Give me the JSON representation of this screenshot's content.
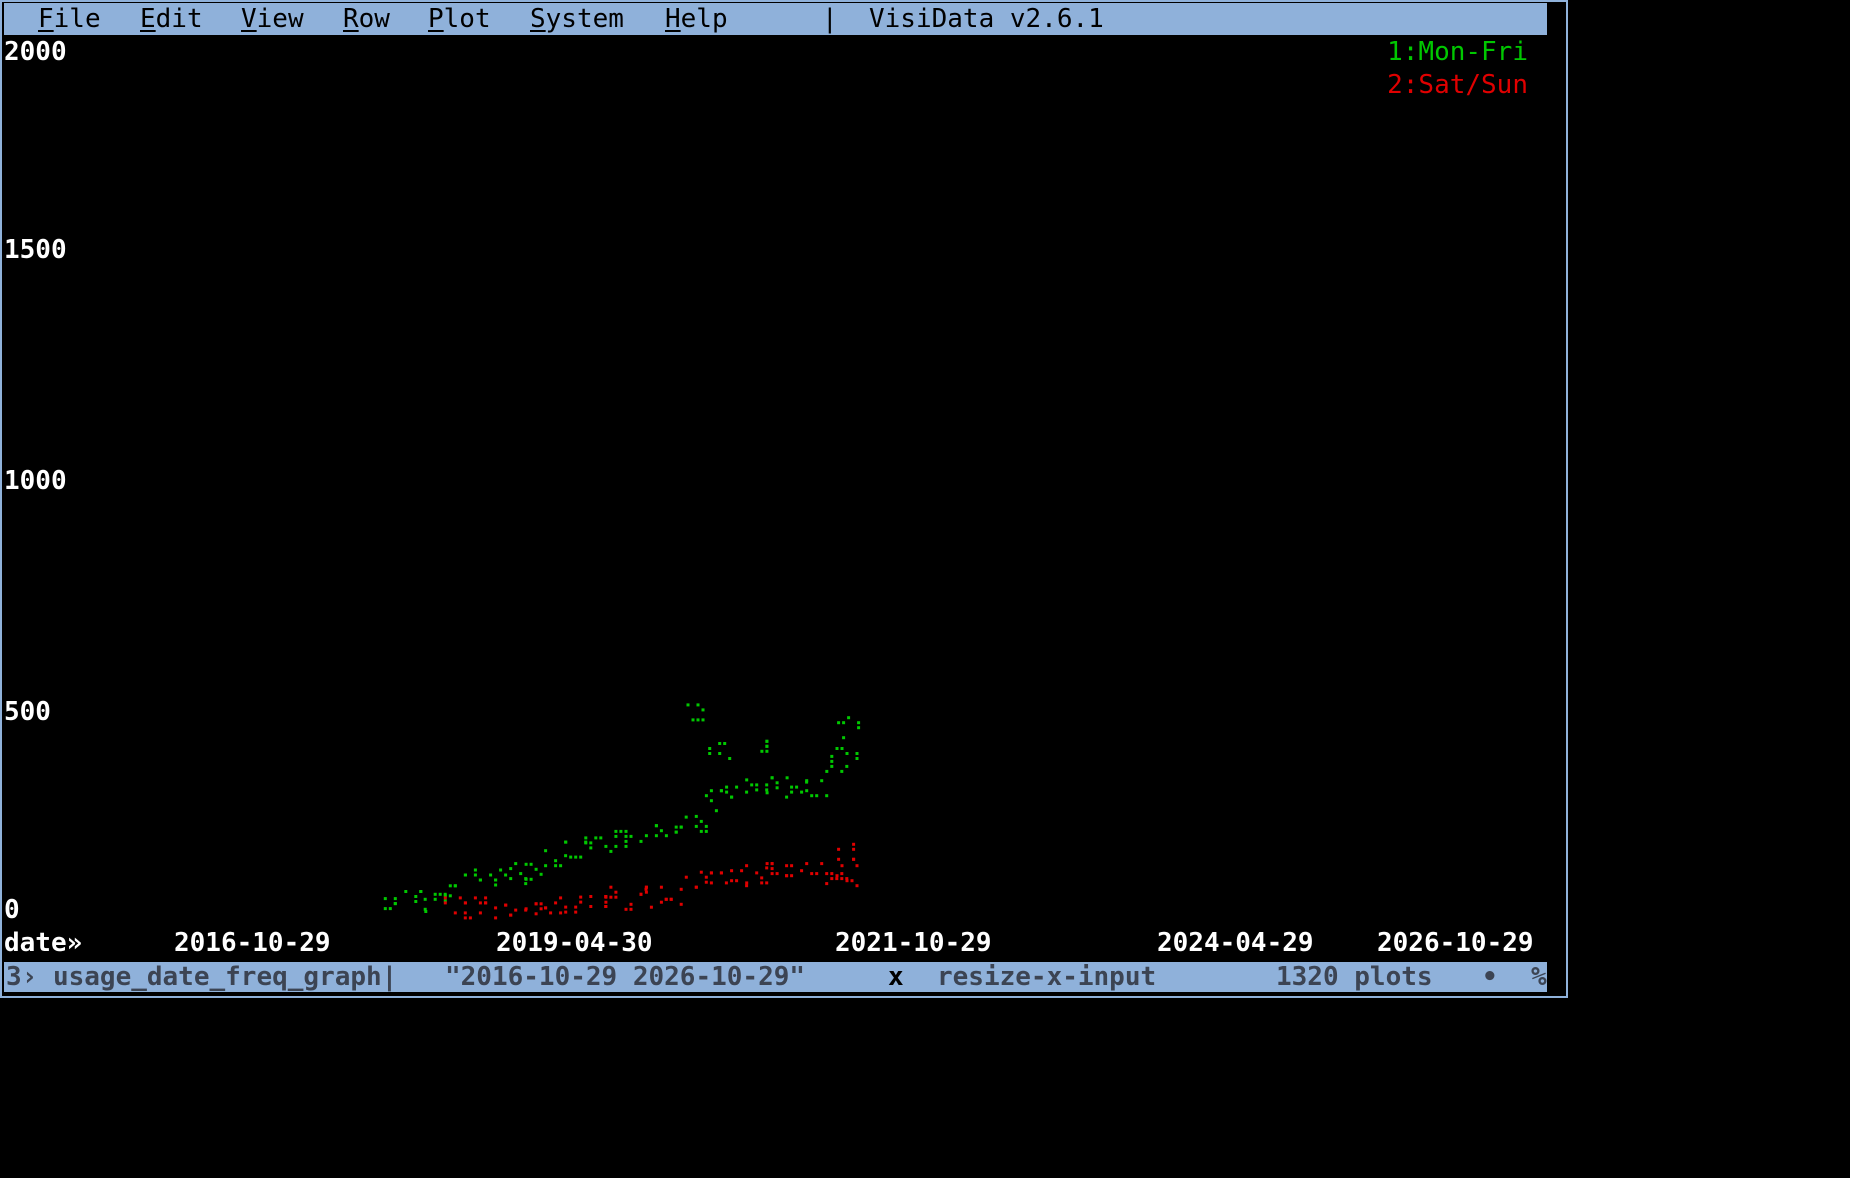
{
  "menu": {
    "items": [
      {
        "first": "F",
        "rest": "ile"
      },
      {
        "first": "E",
        "rest": "dit"
      },
      {
        "first": "V",
        "rest": "iew"
      },
      {
        "first": "R",
        "rest": "ow"
      },
      {
        "first": "P",
        "rest": "lot"
      },
      {
        "first": "S",
        "rest": "ystem"
      },
      {
        "first": "H",
        "rest": "elp"
      }
    ],
    "separator": "|",
    "app_title": "VisiData v2.6.1"
  },
  "chart_data": {
    "type": "scatter",
    "y_ticks": [
      "2000",
      "1500",
      "1000",
      "500",
      "0"
    ],
    "x_ticks": [
      "2016-10-29",
      "2019-04-30",
      "2021-10-29",
      "2024-04-29",
      "2026-10-29"
    ],
    "xlabel": "date»",
    "ylim": [
      0,
      2000
    ],
    "xlim": [
      "2016-10-29",
      "2026-10-29"
    ],
    "legend_position": "top-right",
    "series": [
      {
        "name": "1:Mon-Fri",
        "color": "#00c800",
        "points": [
          [
            "2017-12-15",
            30
          ],
          [
            "2018-02-15",
            35
          ],
          [
            "2018-04-15",
            40
          ],
          [
            "2018-06-15",
            60
          ],
          [
            "2018-08-15",
            85
          ],
          [
            "2018-10-15",
            85
          ],
          [
            "2018-12-15",
            100
          ],
          [
            "2019-02-15",
            110
          ],
          [
            "2019-04-15",
            130
          ],
          [
            "2019-06-15",
            150
          ],
          [
            "2019-08-15",
            160
          ],
          [
            "2019-10-15",
            175
          ],
          [
            "2019-12-15",
            175
          ],
          [
            "2020-02-15",
            200
          ],
          [
            "2020-04-15",
            220
          ],
          [
            "2020-06-15",
            210
          ],
          [
            "2020-08-15",
            270
          ],
          [
            "2020-10-15",
            290
          ],
          [
            "2020-12-15",
            295
          ],
          [
            "2021-02-15",
            300
          ],
          [
            "2021-04-15",
            290
          ],
          [
            "2021-06-15",
            305
          ],
          [
            "2021-08-15",
            350
          ],
          [
            "2021-09-15",
            380
          ],
          [
            "2020-06-20",
            470
          ],
          [
            "2021-09-20",
            440
          ],
          [
            "2021-01-15",
            385
          ],
          [
            "2020-08-25",
            380
          ]
        ]
      },
      {
        "name": "2:Sat/Sun",
        "color": "#e00000",
        "points": [
          [
            "2018-06-15",
            20
          ],
          [
            "2018-08-15",
            20
          ],
          [
            "2018-10-15",
            20
          ],
          [
            "2018-12-15",
            15
          ],
          [
            "2019-02-15",
            18
          ],
          [
            "2019-04-15",
            20
          ],
          [
            "2019-06-15",
            22
          ],
          [
            "2019-08-15",
            35
          ],
          [
            "2019-10-15",
            45
          ],
          [
            "2019-12-15",
            40
          ],
          [
            "2020-02-15",
            45
          ],
          [
            "2020-04-15",
            40
          ],
          [
            "2020-06-15",
            80
          ],
          [
            "2020-08-15",
            90
          ],
          [
            "2020-10-15",
            95
          ],
          [
            "2020-12-15",
            90
          ],
          [
            "2021-02-15",
            100
          ],
          [
            "2021-04-15",
            95
          ],
          [
            "2021-06-15",
            100
          ],
          [
            "2021-08-15",
            100
          ],
          [
            "2021-09-15",
            95
          ],
          [
            "2021-09-20",
            145
          ]
        ]
      }
    ]
  },
  "status": {
    "sheet": "3› usage_date_freq_graph|",
    "input": "\"2016-10-29 2026-10-29\"",
    "keystroke": "x",
    "command": "resize-x-input",
    "plots": "1320 plots",
    "bullet": "•",
    "percent": "%"
  }
}
